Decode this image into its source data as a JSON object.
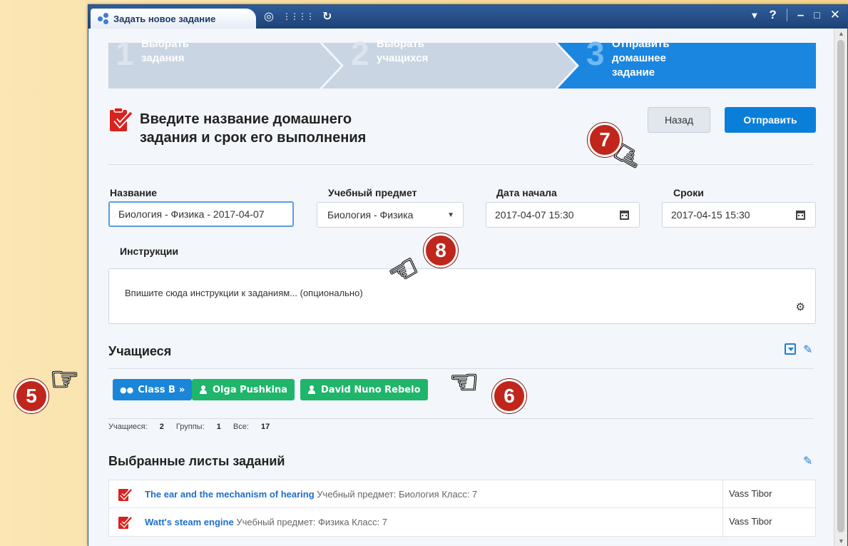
{
  "window": {
    "tab_title": "Задать новое задание"
  },
  "steps": [
    {
      "num": "1",
      "label_line1": "Выбрать",
      "label_line2": "задания",
      "active": false
    },
    {
      "num": "2",
      "label_line1": "Выбрать",
      "label_line2": "учащихся",
      "active": false
    },
    {
      "num": "3",
      "label_line1": "Отправить",
      "label_line2": "домашнее задание",
      "active": true
    }
  ],
  "header": {
    "title_line1": "Введите название домашнего",
    "title_line2": "задания и срок его выполнения",
    "back_label": "Назад",
    "send_label": "Отправить"
  },
  "form": {
    "name_label": "Название",
    "name_value": "Биология - Физика - 2017-04-07",
    "subject_label": "Учебный предмет",
    "subject_value": "Биология - Физика",
    "start_label": "Дата начала",
    "start_value": "2017-04-07 15:30",
    "deadline_label": "Сроки",
    "deadline_value": "2017-04-15 15:30",
    "instructions_label": "Инструкции",
    "instructions_placeholder": "Впишите сюда инструкции к заданиям... (опционально)"
  },
  "students": {
    "title": "Учащиеся",
    "chips": [
      {
        "label": "Class B",
        "suffix": "»",
        "type": "group",
        "color": "#1a86d9"
      },
      {
        "label": "Olga Pushkina",
        "type": "person",
        "color": "#1fb56b"
      },
      {
        "label": "David Nuno Rebelo",
        "type": "person",
        "color": "#1fb56b"
      }
    ],
    "stats": {
      "students_label": "Учащиеся:",
      "students_value": "2",
      "groups_label": "Группы:",
      "groups_value": "1",
      "all_label": "Все:",
      "all_value": "17"
    }
  },
  "worksheets": {
    "title": "Выбранные листы заданий",
    "rows": [
      {
        "title": "The ear and the mechanism of hearing",
        "meta": "Учебный предмет: Биология Класс: 7",
        "author": "Vass Tibor"
      },
      {
        "title": "Watt's steam engine",
        "meta": "Учебный предмет: Физика Класс: 7",
        "author": "Vass Tibor"
      }
    ]
  },
  "callouts": {
    "c5": "5",
    "c6": "6",
    "c7": "7",
    "c8": "8"
  },
  "colors": {
    "accent": "#0a7fd9",
    "chip_green": "#1fb56b",
    "titlebar": "#1d4277",
    "callout": "#c0261b"
  }
}
